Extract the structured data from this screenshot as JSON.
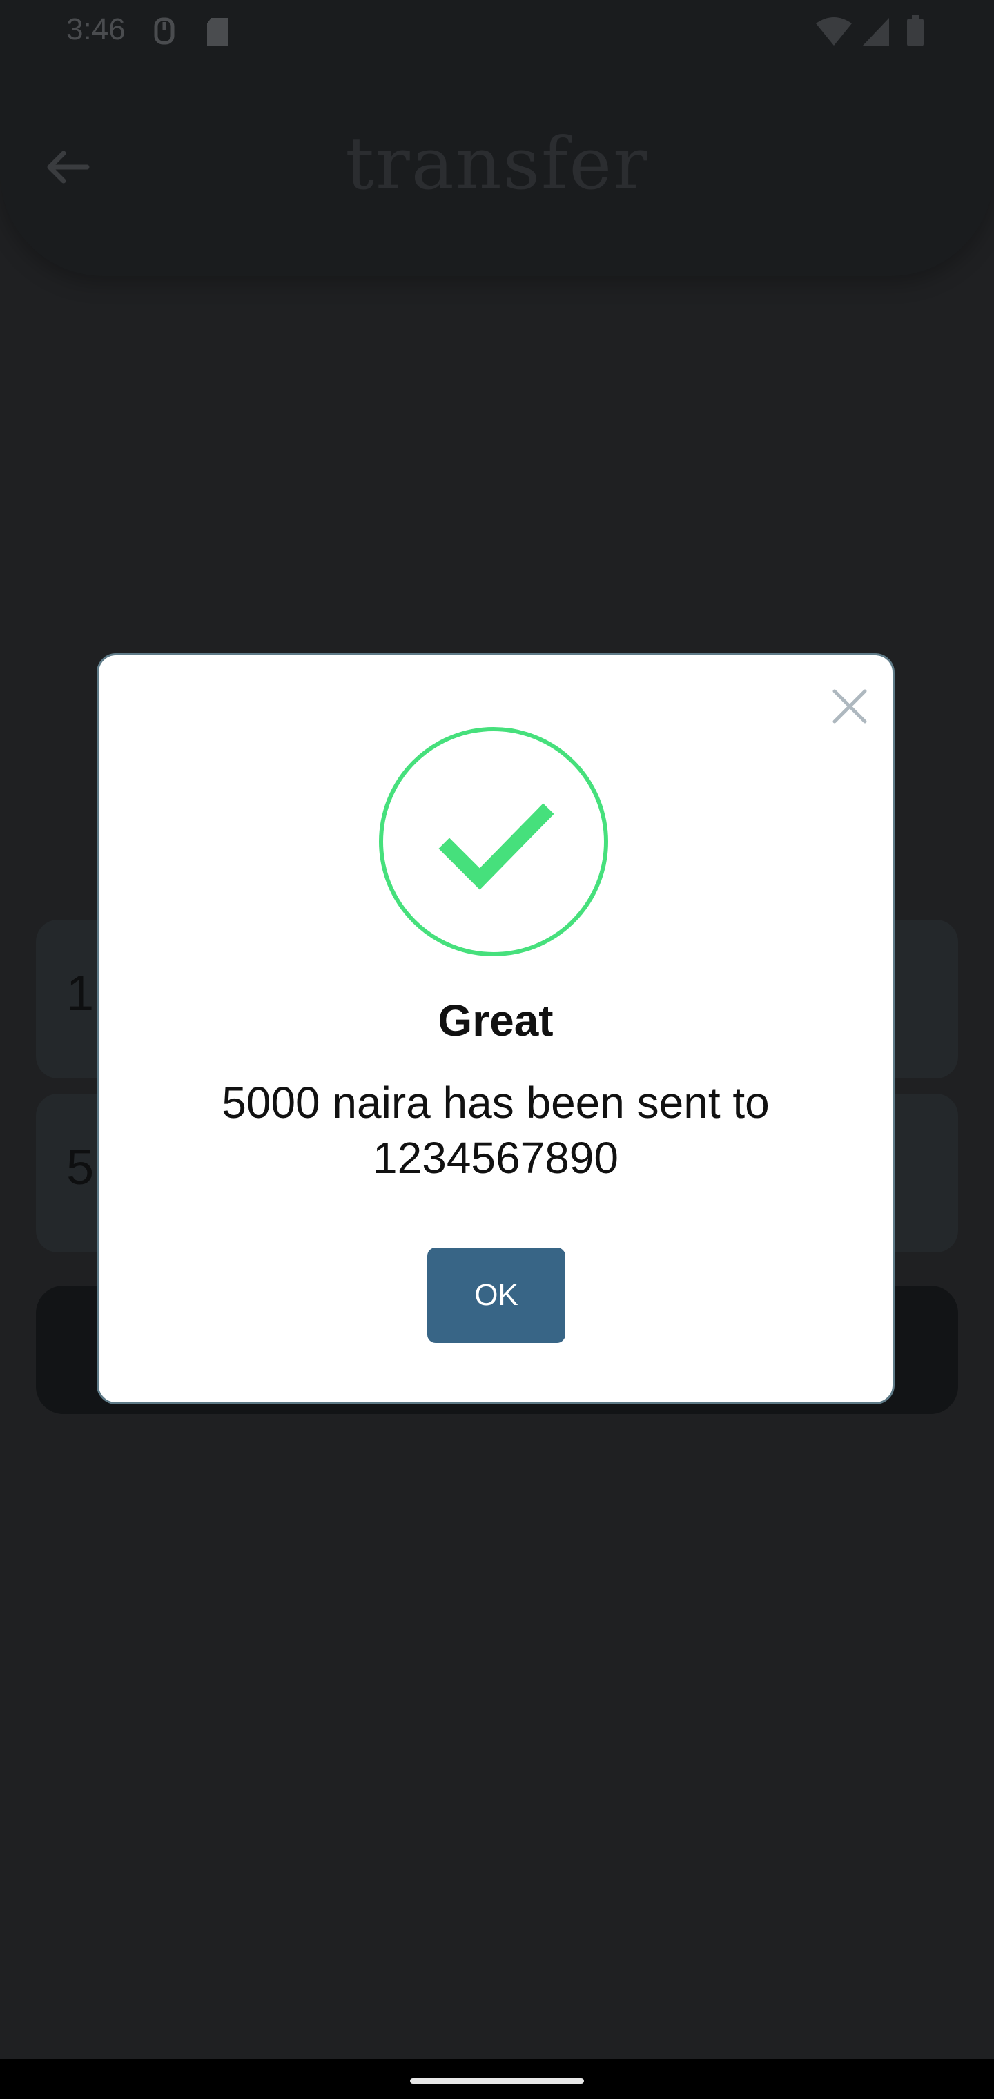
{
  "status_bar": {
    "time": "3:46"
  },
  "header": {
    "title": "transfer",
    "back_icon": "arrow-left-icon"
  },
  "background": {
    "cards": [
      {
        "text": "1"
      },
      {
        "text": "5"
      }
    ]
  },
  "dialog": {
    "close_icon": "close-icon",
    "status_icon": "checkmark-icon",
    "title": "Great",
    "message": "5000 naira has been sent to 1234567890",
    "ok_label": "OK"
  },
  "colors": {
    "success": "#46e07c",
    "primary_button": "#386586",
    "dialog_border": "#5e7a87",
    "background": "#1f2022"
  }
}
